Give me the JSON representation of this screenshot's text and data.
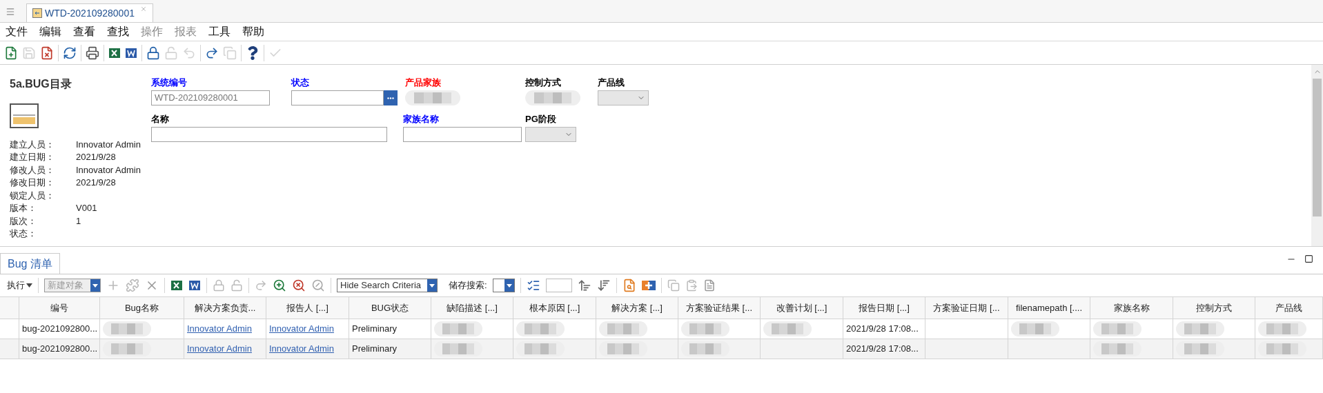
{
  "tabs": [
    {
      "label": "WTD-202109280001",
      "selected": true
    }
  ],
  "menu": [
    {
      "label": "文件",
      "disabled": false
    },
    {
      "label": "编辑",
      "disabled": false
    },
    {
      "label": "查看",
      "disabled": false
    },
    {
      "label": "查找",
      "disabled": false
    },
    {
      "label": "操作",
      "disabled": true
    },
    {
      "label": "报表",
      "disabled": true
    },
    {
      "label": "工具",
      "disabled": false
    },
    {
      "label": "帮助",
      "disabled": false
    }
  ],
  "toolbar": [
    {
      "disabled": false
    },
    {
      "disabled": true
    },
    {
      "disabled": false
    },
    {
      "disabled": false
    },
    {
      "disabled": false
    },
    {
      "disabled": false
    },
    {
      "disabled": false
    },
    {
      "disabled": false
    },
    {
      "disabled": true
    },
    {
      "disabled": true
    },
    {
      "disabled": false
    },
    {
      "disabled": true
    },
    {
      "disabled": false
    },
    {
      "disabled": true
    }
  ],
  "form": {
    "title": "5a.BUG目录",
    "info": [
      {
        "label": "建立人员：",
        "value": "Innovator Admin"
      },
      {
        "label": "建立日期：",
        "value": "2021/9/28"
      },
      {
        "label": "修改人员：",
        "value": "Innovator Admin"
      },
      {
        "label": "修改日期：",
        "value": "2021/9/28"
      },
      {
        "label": "锁定人员："
      },
      {
        "label": "版本：",
        "value": "V001"
      },
      {
        "label": "版次：",
        "value": "1"
      },
      {
        "label": "状态："
      }
    ],
    "row1": [
      {
        "label": "系统编号",
        "color": "#0000ff",
        "kind": "text",
        "value": "WTD-202109280001"
      },
      {
        "label": "状态",
        "color": "#0000ff",
        "kind": "picker"
      },
      {
        "label": "产品家族",
        "color": "#ff0000",
        "kind": "redacted"
      },
      {
        "label": "控制方式",
        "color": "#000000",
        "kind": "redacted"
      },
      {
        "label": "产品线",
        "color": "#000000",
        "kind": "select"
      }
    ],
    "row2": [
      {
        "label": "名称",
        "color": "#000000",
        "kind": "wide"
      },
      {
        "label": "家族名称",
        "color": "#0000ff",
        "kind": "text"
      },
      {
        "label": "PG阶段",
        "color": "#000000",
        "kind": "select"
      }
    ]
  },
  "list": {
    "tab": {
      "label": "Bug 清单",
      "selected": true
    },
    "execute": "执行",
    "new_object": {
      "placeholder": "新建对象"
    },
    "search_mode": "Hide Search Criteria",
    "saved_search": "储存搜索:",
    "columns": [
      "编号",
      "Bug名称",
      "解决方案负责...",
      "报告人 [...]",
      "BUG状态",
      "缺陷描述 [...]",
      "根本原因 [...]",
      "解决方案 [...]",
      "方案验证结果 [...",
      "改善计划 [...]",
      "报告日期 [...]",
      "方案验证日期 [...",
      "filenamepath [....",
      "家族名称",
      "控制方式",
      "产品线"
    ],
    "rows": [
      {
        "cells": [
          {
            "kind": "text",
            "text": "bug-2021092800..."
          },
          {
            "kind": "redacted"
          },
          {
            "kind": "link",
            "text": "Innovator Admin"
          },
          {
            "kind": "link",
            "text": "Innovator Admin"
          },
          {
            "kind": "text",
            "text": "Preliminary"
          },
          {
            "kind": "redacted"
          },
          {
            "kind": "redacted"
          },
          {
            "kind": "redacted"
          },
          {
            "kind": "redacted"
          },
          {
            "kind": "redacted"
          },
          {
            "kind": "text",
            "text": "2021/9/28 17:08..."
          },
          {
            "kind": "empty"
          },
          {
            "kind": "redacted"
          },
          {
            "kind": "redacted"
          },
          {
            "kind": "redacted"
          },
          {
            "kind": "redacted"
          }
        ]
      },
      {
        "cells": [
          {
            "kind": "text",
            "text": "bug-2021092800..."
          },
          {
            "kind": "redacted"
          },
          {
            "kind": "link",
            "text": "Innovator Admin"
          },
          {
            "kind": "link",
            "text": "Innovator Admin"
          },
          {
            "kind": "text",
            "text": "Preliminary"
          },
          {
            "kind": "redacted"
          },
          {
            "kind": "redacted"
          },
          {
            "kind": "redacted"
          },
          {
            "kind": "redacted"
          },
          {
            "kind": "empty"
          },
          {
            "kind": "text",
            "text": "2021/9/28 17:08..."
          },
          {
            "kind": "empty"
          },
          {
            "kind": "empty"
          },
          {
            "kind": "redacted"
          },
          {
            "kind": "redacted"
          },
          {
            "kind": "redacted"
          }
        ]
      }
    ]
  }
}
